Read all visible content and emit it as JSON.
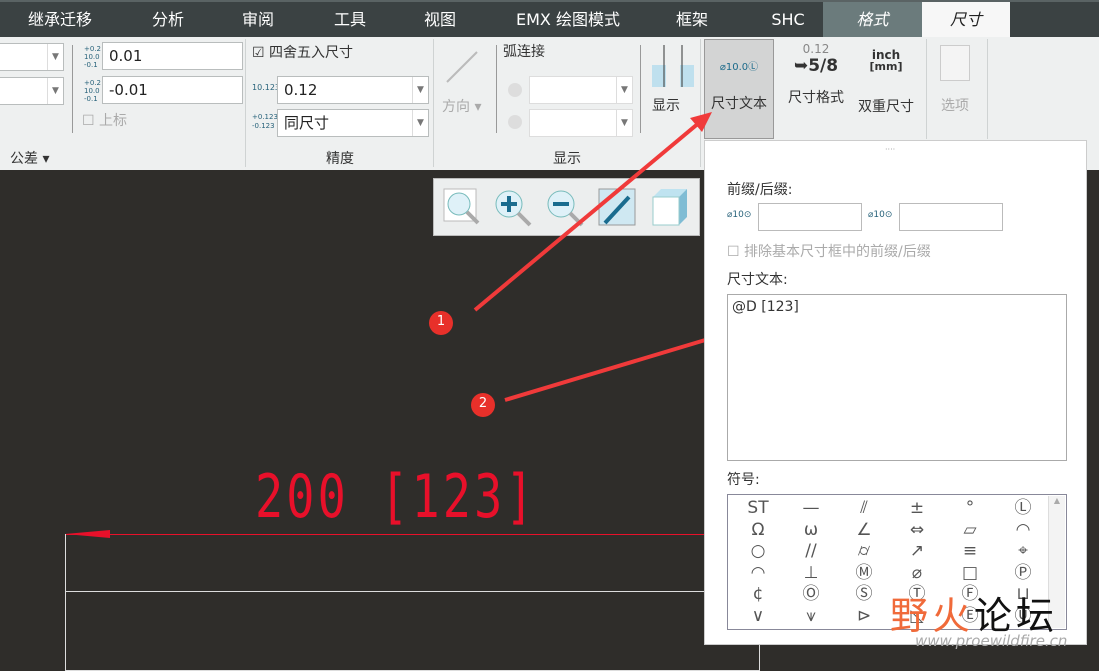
{
  "tabs": [
    "继承迁移",
    "分析",
    "审阅",
    "工具",
    "视图",
    "EMX 绘图模式",
    "框架",
    "SHC",
    "格式",
    "尺寸"
  ],
  "ribbon": {
    "tolerance": {
      "upper": "0.01",
      "lower": "-0.01",
      "superscript_label": "上标",
      "group_label": "公差"
    },
    "precision": {
      "round_label": "四舍五入尺寸",
      "round_checked": true,
      "decimal": "0.12",
      "tol_decimal": "同尺寸",
      "group_label": "精度",
      "icon_decimal": "10.123"
    },
    "display": {
      "direction_label": "方向",
      "arc_label": "弧连接",
      "show_label": "显示",
      "group_label": "显示"
    },
    "dim_text_label": "尺寸文本",
    "dim_text_icon": "⌀10.0Ⓛ",
    "dim_format_label": "尺寸格式",
    "dim_format_icon_top": "0.12",
    "dim_format_icon_bottom": "5/8",
    "dual_label": "双重尺寸",
    "dual_icon_top": "inch",
    "dual_icon_bottom": "[mm]",
    "options_label": "选项"
  },
  "canvas": {
    "dimension_text": "200  [123]",
    "dimension_color": "#e8102a",
    "annotation_1": "1",
    "annotation_2": "2"
  },
  "dialog": {
    "prefix_suffix_label": "前缀/后缀:",
    "prefix_icon": "⌀10⊙",
    "suffix_icon": "⌀10⊙",
    "prefix": "",
    "suffix": "",
    "exclude_label": "排除基本尺寸框中的前缀/后缀",
    "exclude_checked": false,
    "dim_text_label": "尺寸文本:",
    "dim_text_value": "@D  [123]",
    "symbols_label": "符号:",
    "symbols": [
      "ST",
      "—",
      "⫽",
      "±",
      "°",
      "Ⓛ",
      "Ω",
      "ω",
      "∠",
      "⇔",
      "▱",
      "◠",
      "○",
      "//",
      "⌭",
      "↗",
      "≡",
      "⌖",
      "◠",
      "⊥",
      "Ⓜ",
      "⌀",
      "□",
      "Ⓟ",
      "¢",
      "Ⓞ",
      "Ⓢ",
      "Ⓣ",
      "Ⓕ",
      "⊔",
      "∨",
      "⩛",
      "⊳",
      "◺",
      "Ⓔ",
      "Ⓤ"
    ]
  },
  "watermark": {
    "text": "野火论坛",
    "url": "www.proewildfire.cn"
  }
}
